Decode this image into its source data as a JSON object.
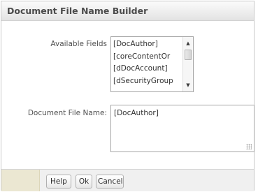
{
  "dialog": {
    "title": "Document File Name Builder"
  },
  "available_fields": {
    "label": "Available Fields",
    "items": [
      "[DocAuthor]",
      "[coreContentOr",
      "[dDocAccount]",
      "[dSecurityGroup"
    ],
    "scroll_up_icon": "▲",
    "scroll_down_icon": "▼"
  },
  "document_file_name": {
    "label": "Document File Name:",
    "value": "[DocAuthor]"
  },
  "buttons": {
    "help": "Help",
    "ok": "Ok",
    "cancel": "Cancel"
  },
  "colors": {
    "title_text": "#4b4b4b",
    "footer_accent": "#ebe7d2"
  }
}
